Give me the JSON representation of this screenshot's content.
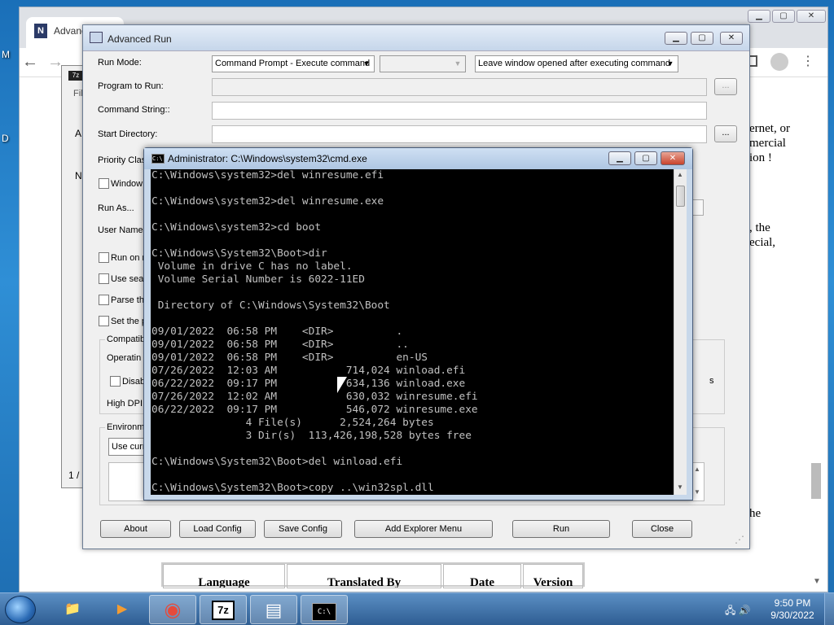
{
  "desktop": {
    "left_label_1": "M",
    "left_label_2": "D"
  },
  "browser": {
    "tab_title": "Advance",
    "tab_icon": "N",
    "back_icon": "←",
    "forward_icon": "→",
    "partial_text_1": "ernet, or",
    "partial_text_2": "mercial",
    "partial_text_3": "ion !",
    "partial_text_4": ", the",
    "partial_text_5": "ecial,",
    "partial_text_6": "he",
    "table_headers": [
      "Language",
      "Translated By",
      "Date",
      "Version"
    ]
  },
  "sevenzip": {
    "title_icon": "7z",
    "menu_hint": "Fil",
    "item_hint": "A",
    "name_hint": "N",
    "status": "1 /"
  },
  "advanced_run": {
    "title": "Advanced Run",
    "labels": {
      "run_mode": "Run Mode:",
      "program": "Program to Run:",
      "command_string": "Command String::",
      "start_dir": "Start Directory:",
      "priority": "Priority Clas",
      "window": "Window",
      "run_as": "Run As...",
      "user_name": "User Name:",
      "compat": "Compatib",
      "operating": "Operatin",
      "high_dpi": "High DPI",
      "environment": "Environme"
    },
    "run_mode_value": "Command Prompt - Execute command",
    "after_value": "Leave window opened after executing command",
    "browse_label": "...",
    "checkboxes": [
      "Run on r",
      "Use sear",
      "Parse th",
      "Set the p"
    ],
    "disable_label": "Disab",
    "use_current_label": "Use curr",
    "buttons": {
      "about": "About",
      "load": "Load Config",
      "save": "Save Config",
      "explorer": "Add Explorer Menu",
      "run": "Run",
      "close": "Close"
    }
  },
  "cmd": {
    "title": "Administrator: C:\\Windows\\system32\\cmd.exe",
    "icon_label": "C:\\",
    "lines": [
      "C:\\Windows\\system32>del winresume.efi",
      "",
      "C:\\Windows\\system32>del winresume.exe",
      "",
      "C:\\Windows\\system32>cd boot",
      "",
      "C:\\Windows\\System32\\Boot>dir",
      " Volume in drive C has no label.",
      " Volume Serial Number is 6022-11ED",
      "",
      " Directory of C:\\Windows\\System32\\Boot",
      "",
      "09/01/2022  06:58 PM    <DIR>          .",
      "09/01/2022  06:58 PM    <DIR>          ..",
      "09/01/2022  06:58 PM    <DIR>          en-US",
      "07/26/2022  12:03 AM           714,024 winload.efi",
      "06/22/2022  09:17 PM           634,136 winload.exe",
      "07/26/2022  12:02 AM           630,032 winresume.efi",
      "06/22/2022  09:17 PM           546,072 winresume.exe",
      "               4 File(s)      2,524,264 bytes",
      "               3 Dir(s)  113,426,198,528 bytes free",
      "",
      "C:\\Windows\\System32\\Boot>del winload.efi",
      "",
      "C:\\Windows\\System32\\Boot>copy ..\\win32spl.dll"
    ]
  },
  "taskbar": {
    "items": [
      "explorer",
      "media-player",
      "chrome",
      "7-zip",
      "advanced-run",
      "cmd"
    ],
    "item_glyphs": [
      "📁",
      "▶",
      "◉",
      "7z",
      "▤",
      "C:\\"
    ],
    "time": "9:50 PM",
    "date": "9/30/2022",
    "tray_glyphs": "🖧 🔊"
  }
}
